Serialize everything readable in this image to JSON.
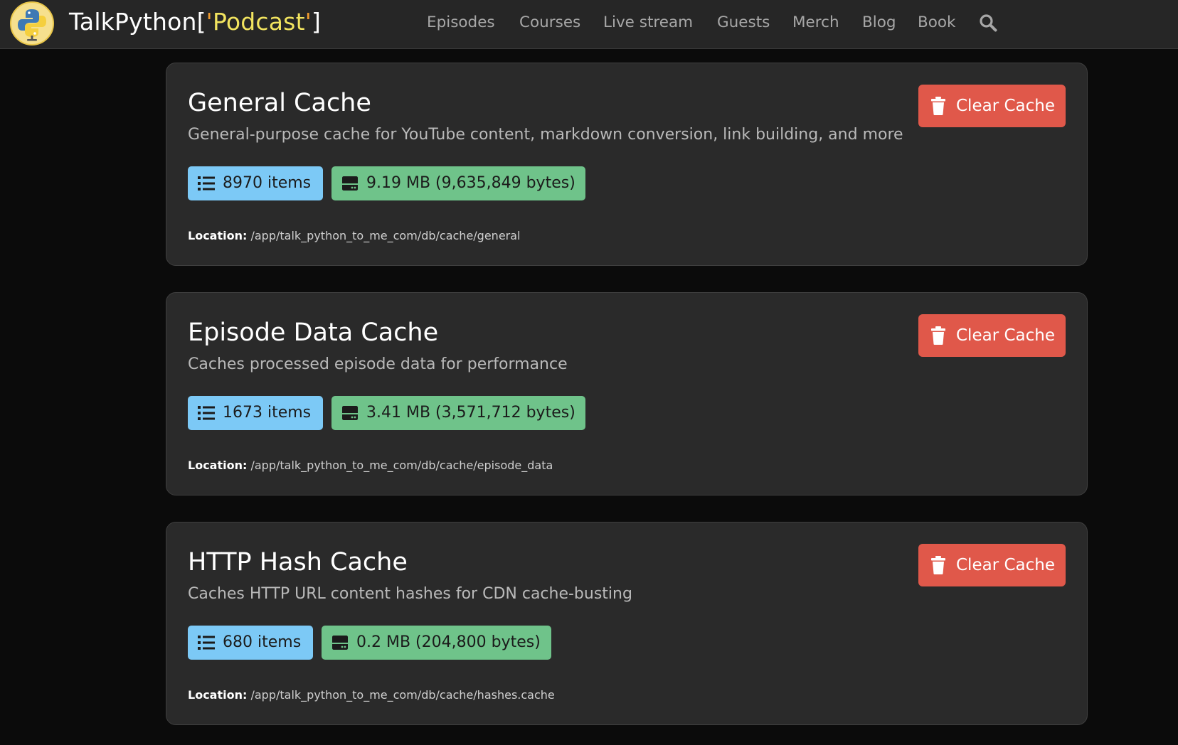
{
  "nav": {
    "brand": {
      "prefix": "TalkPython[",
      "open_quote": "'",
      "word": "Podcast",
      "close_quote": "'",
      "suffix": "]"
    },
    "items": [
      "Episodes",
      "Courses",
      "Live stream",
      "Guests",
      "Merch",
      "Blog",
      "Book"
    ],
    "search_icon": "search-icon"
  },
  "colors": {
    "navbar_bg": "#262626",
    "page_bg": "#0b0b0b",
    "card_bg": "#2a2a2a",
    "danger": "#e0584a",
    "info_badge": "#7cc9f6",
    "success_badge": "#6fc38a",
    "brand_quote": "#f09b2e",
    "brand_word": "#f2e45f"
  },
  "caches": [
    {
      "title": "General Cache",
      "description": "General-purpose cache for YouTube content, markdown conversion, link building, and more",
      "clear_label": "Clear Cache",
      "items_text": "8970 items",
      "size_text": "9.19 MB (9,635,849 bytes)",
      "location_label": "Location:",
      "location_path": "/app/talk_python_to_me_com/db/cache/general"
    },
    {
      "title": "Episode Data Cache",
      "description": "Caches processed episode data for performance",
      "clear_label": "Clear Cache",
      "items_text": "1673 items",
      "size_text": "3.41 MB (3,571,712 bytes)",
      "location_label": "Location:",
      "location_path": "/app/talk_python_to_me_com/db/cache/episode_data"
    },
    {
      "title": "HTTP Hash Cache",
      "description": "Caches HTTP URL content hashes for CDN cache-busting",
      "clear_label": "Clear Cache",
      "items_text": "680 items",
      "size_text": "0.2 MB (204,800 bytes)",
      "location_label": "Location:",
      "location_path": "/app/talk_python_to_me_com/db/cache/hashes.cache"
    }
  ]
}
